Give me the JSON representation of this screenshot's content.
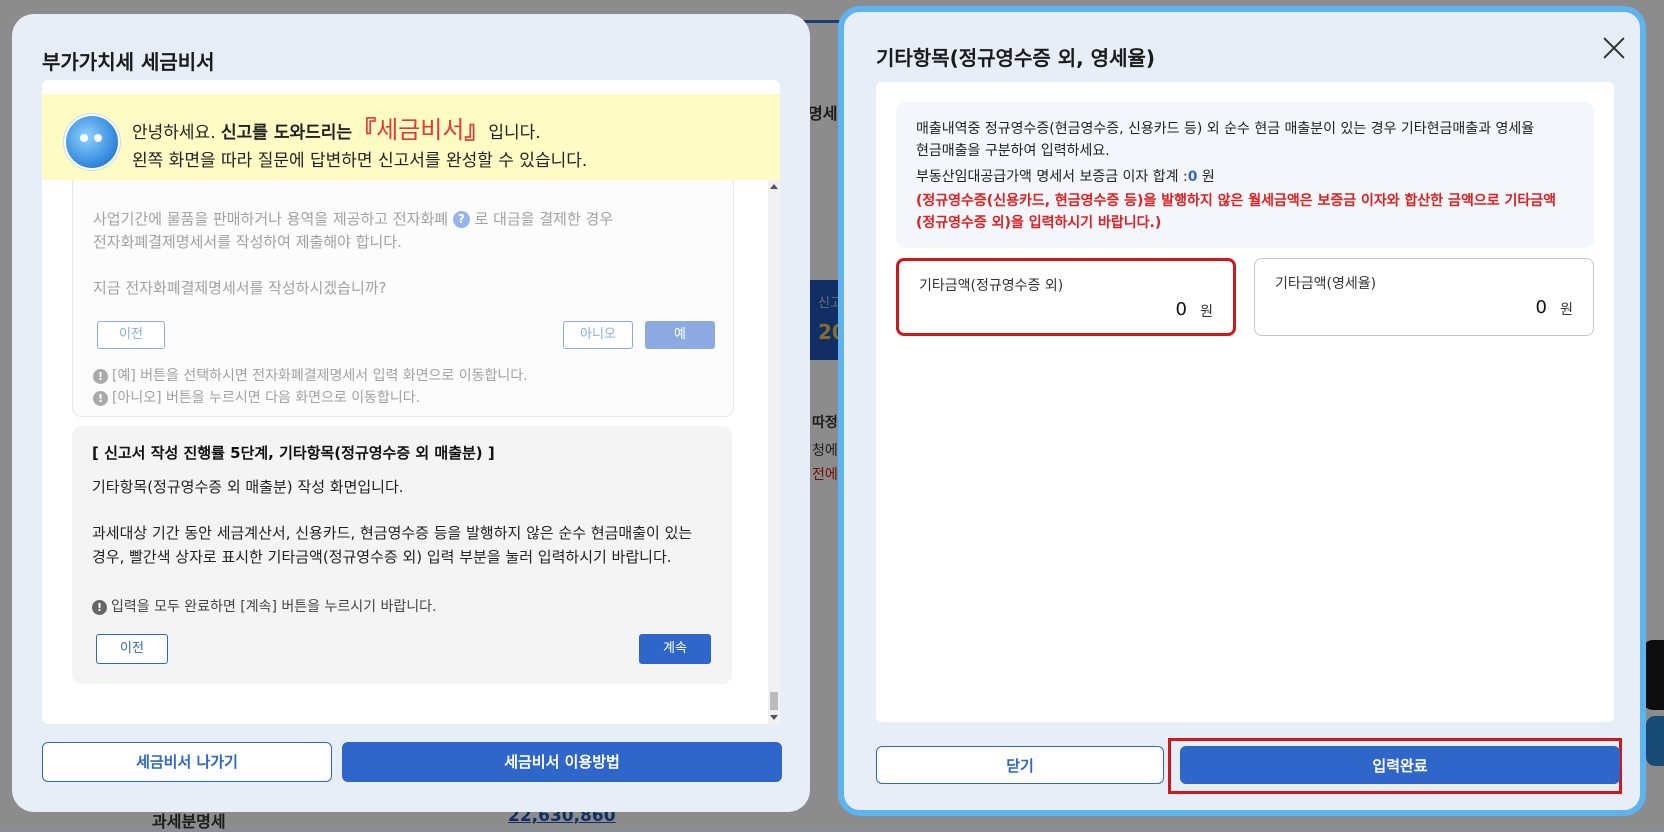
{
  "colors": {
    "accent": "#2f66c9",
    "highlight_red": "#d01818",
    "notice_red": "#e02020",
    "banner_yellow": "#fefcc4",
    "panel_border": "#5db4ee"
  },
  "background": {
    "box_label": "신고",
    "box_value": "20",
    "side_text_1": "명세",
    "side_text_2": "따정",
    "side_text_3": "청에",
    "side_text_4": "전에",
    "bottom_label": "과세분명세",
    "bottom_value": "22,630,860"
  },
  "left_panel": {
    "title": "부가가치세 세금비서",
    "banner": {
      "greeting": "안녕하세요.",
      "intro": "신고를 도와드리는",
      "brand_open": "『",
      "brand": "세금비서",
      "brand_close": "』",
      "tail": "입니다.",
      "line2": "왼쪽 화면을 따라 질문에 답변하면 신고서를 완성할 수 있습니다."
    },
    "previous_question": {
      "line1_a": "사업기간에 물품을 판매하거나 용역을 제공하고 전자화폐",
      "help_icon": "question-icon",
      "line1_b": "로 대금을 결제한 경우",
      "line2": "전자화폐결제명세서를 작성하여 제출해야 합니다.",
      "line3": "지금 전자화폐결제명세서를 작성하시겠습니까?",
      "prev_label": "이전",
      "no_label": "아니오",
      "yes_label": "예",
      "note1": "[예] 버튼을 선택하시면 전자화폐결제명세서 입력 화면으로 이동합니다.",
      "note2": "[아니오] 버튼을 누르시면 다음 화면으로 이동합니다."
    },
    "guide": {
      "title": "[ 신고서 작성 진행률 5단계, 기타항목(정규영수증 외 매출분) ]",
      "line1": "기타항목(정규영수증 외 매출분) 작성 화면입니다.",
      "line2": "과세대상 기간 동안 세금계산서, 신용카드, 현금영수증 등을 발행하지 않은 순수 현금매출이 있는",
      "line3": "경우, 빨간색 상자로 표시한 기타금액(정규영수증 외) 입력 부분을 눌러 입력하시기 바랍니다.",
      "note": "입력을 모두 완료하면 [계속] 버튼을 누르시기 바랍니다.",
      "prev_label": "이전",
      "continue_label": "계속"
    },
    "exit_label": "세금비서 나가기",
    "howto_label": "세금비서 이용방법"
  },
  "right_panel": {
    "title": "기타항목(정규영수증 외, 영세율)",
    "info": {
      "line1": "매출내역중 정규영수증(현금영수증, 신용카드 등) 외 순수 현금 매출분이 있는 경우 기타현금매출과 영세율",
      "line2": "현금매출을 구분하여 입력하세요.",
      "deposit_label": "부동산임대공급가액 명세서 보증금 이자 합계 :",
      "deposit_value": "0",
      "deposit_unit": "원",
      "red_line1": "(정규영수증(신용카드, 현금영수증 등)을 발행하지 않은 월세금액은 보증금 이자와 합산한 금액으로 기타금액",
      "red_line2": "(정규영수증 외)을 입력하시기 바랍니다.)"
    },
    "field_regular": {
      "label": "기타금액(정규영수증 외)",
      "value": "0",
      "unit": "원"
    },
    "field_zero_rate": {
      "label": "기타금액(영세율)",
      "value": "0",
      "unit": "원"
    },
    "close_label": "닫기",
    "submit_label": "입력완료"
  }
}
